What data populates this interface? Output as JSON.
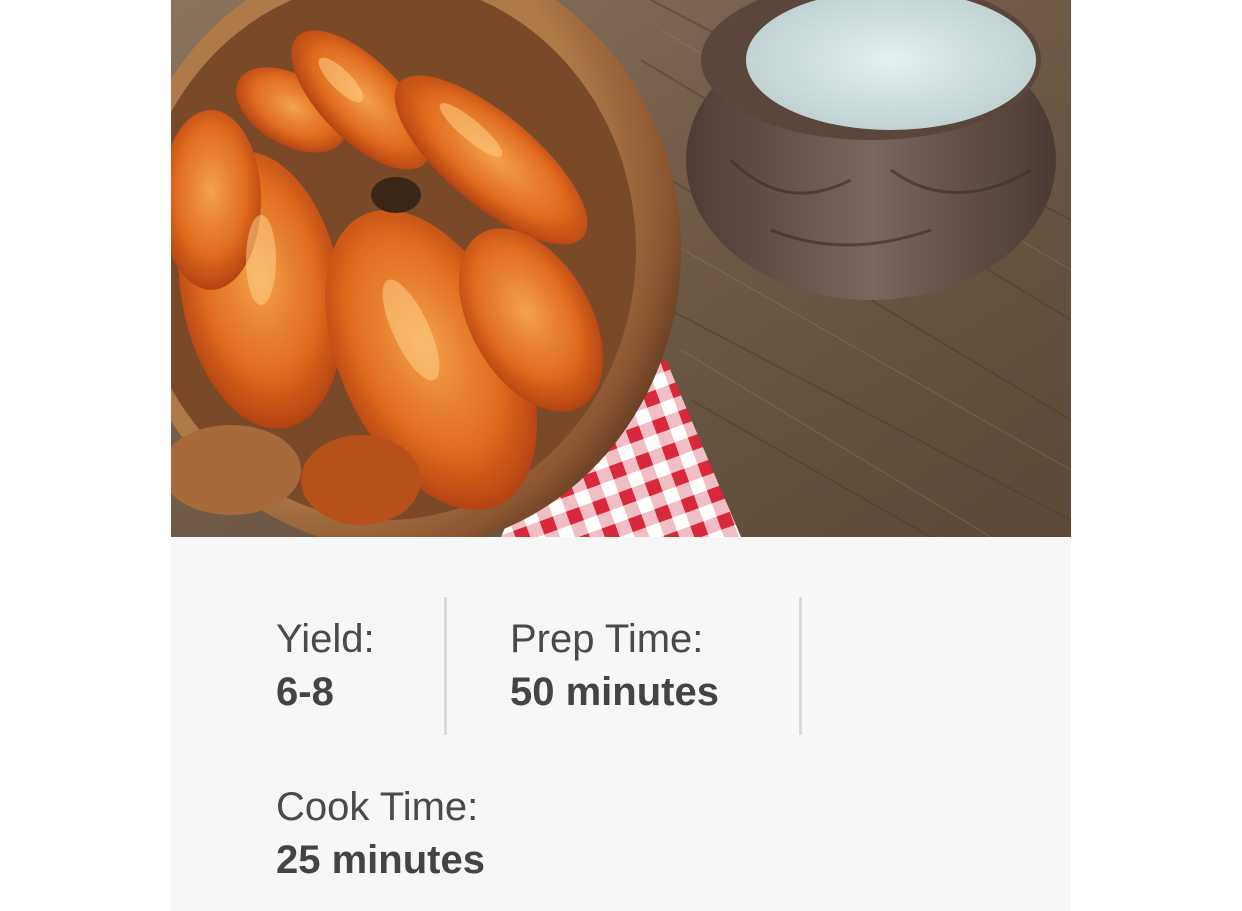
{
  "hero": {
    "image_description_icon": "buffalo-wings-photo"
  },
  "recipe_meta": {
    "yield_label": "Yield:",
    "yield_value": "6-8",
    "prep_label": "Prep Time:",
    "prep_value": "50 minutes",
    "cook_label": "Cook Time:",
    "cook_value": "25 minutes"
  },
  "colors": {
    "panel_bg": "#f7f7f7",
    "text": "#444444",
    "divider": "#d9d9d9"
  }
}
